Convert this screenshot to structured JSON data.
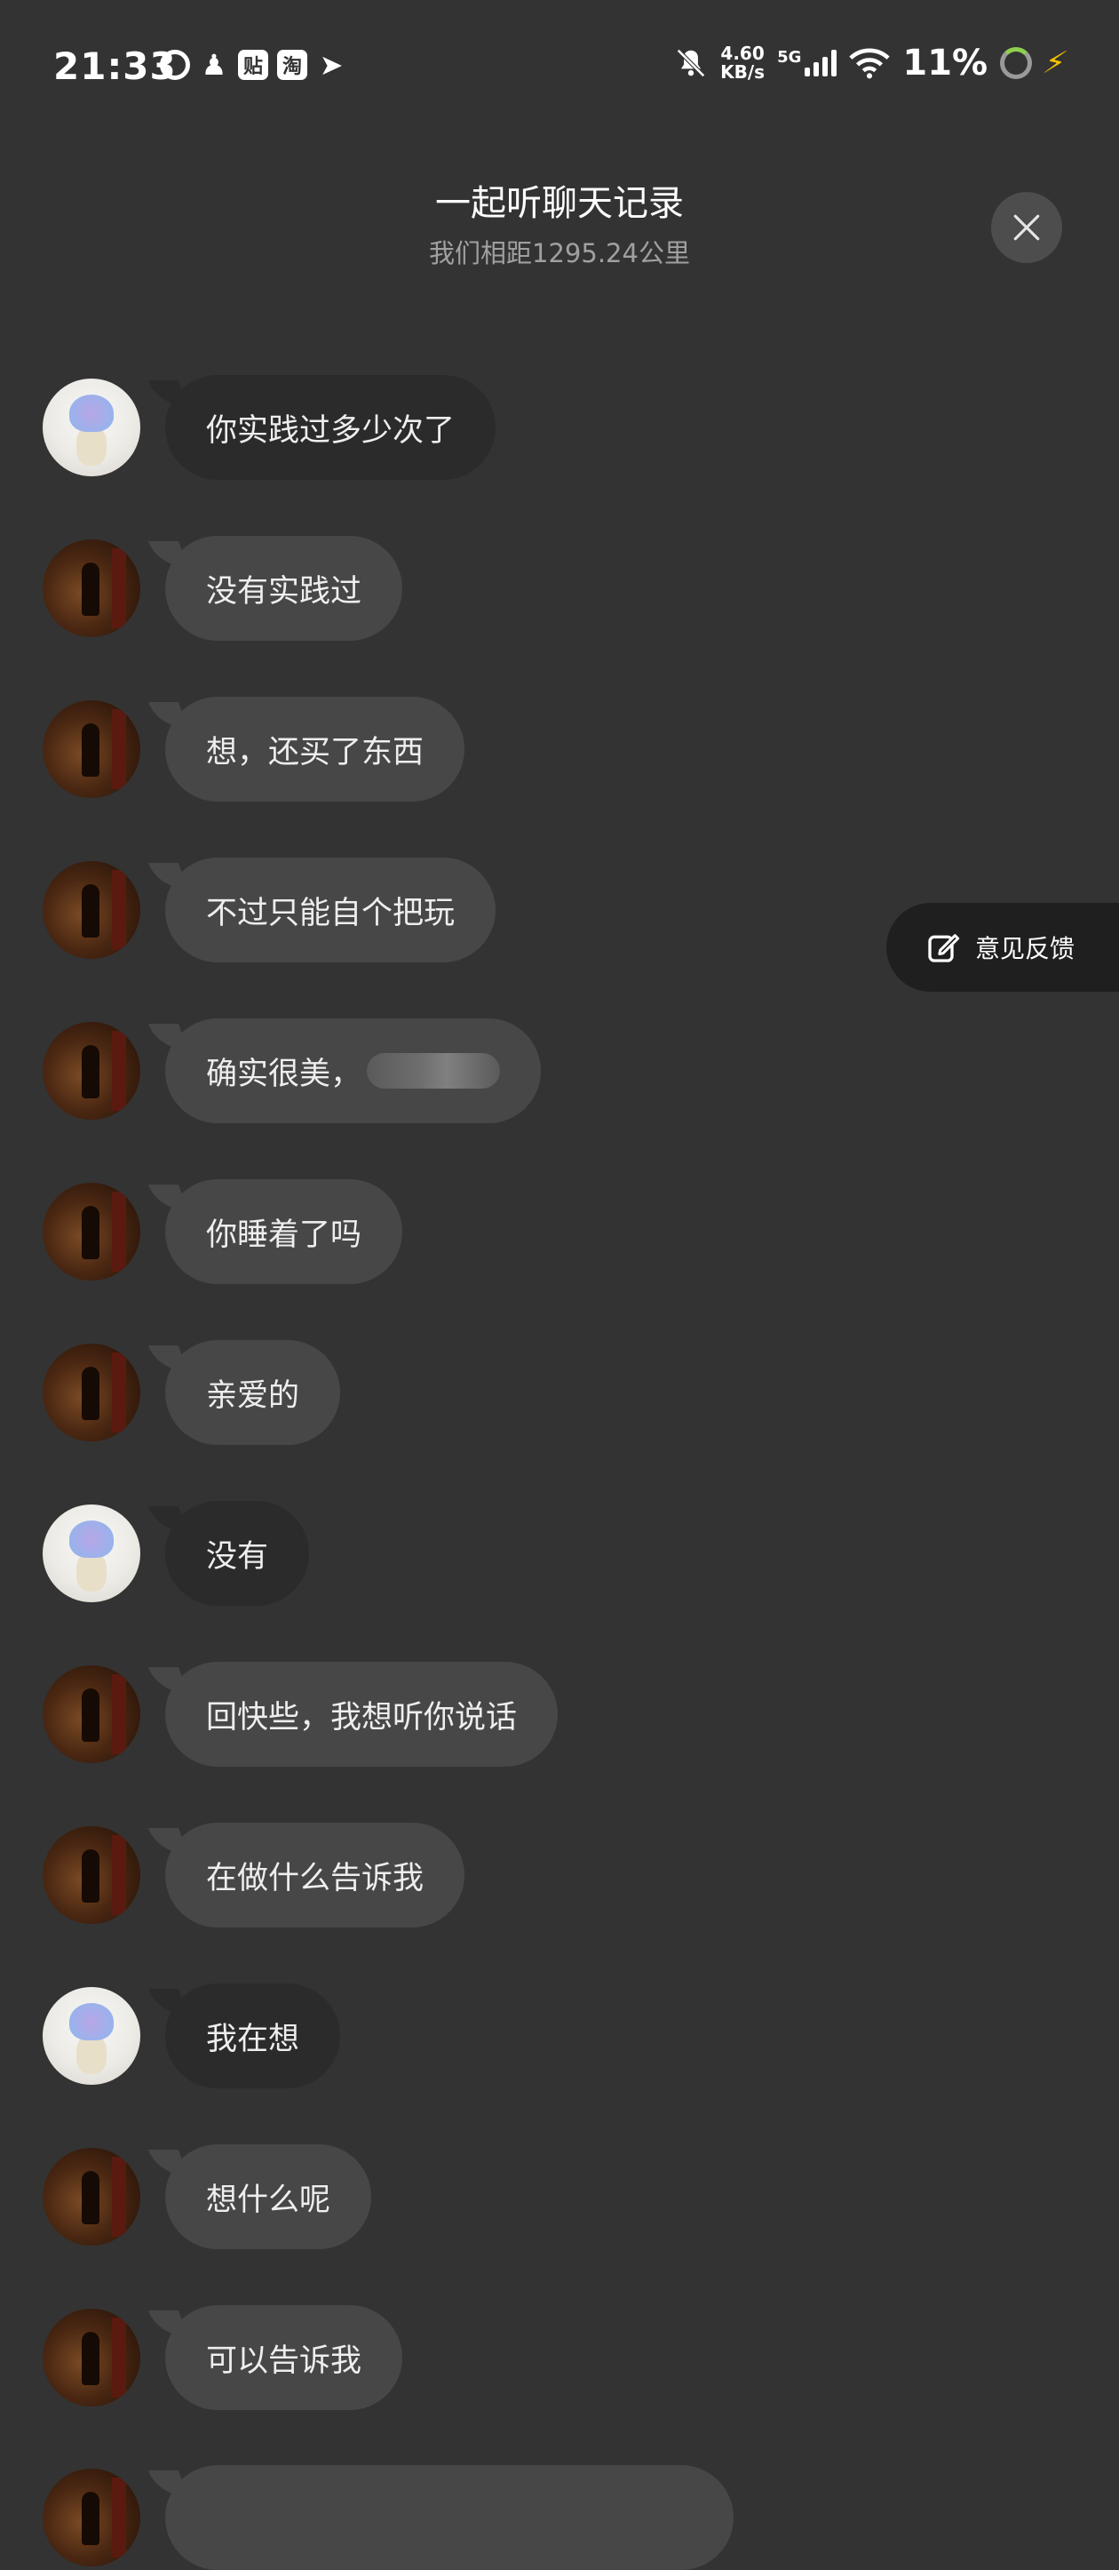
{
  "status_bar": {
    "time": "21:33",
    "app_icons": [
      "weibo-icon",
      "fitness-icon",
      "tieba-icon",
      "taobao-icon",
      "alipay-icon"
    ],
    "app_icon_chars": {
      "tieba": "贴",
      "taobao": "淘"
    },
    "net_speed_value": "4.60",
    "net_speed_unit": "KB/s",
    "network": "5G",
    "battery": "11%"
  },
  "header": {
    "title": "一起听聊天记录",
    "subtitle": "我们相距1295.24公里"
  },
  "messages": [
    {
      "sender": "me",
      "text": "你实践过多少次了"
    },
    {
      "sender": "other",
      "text": "没有实践过"
    },
    {
      "sender": "other",
      "text": "想，还买了东西"
    },
    {
      "sender": "other",
      "text": "不过只能自个把玩"
    },
    {
      "sender": "other",
      "text": "确实很美，"
    },
    {
      "sender": "other",
      "text": "你睡着了吗"
    },
    {
      "sender": "other",
      "text": "亲爱的"
    },
    {
      "sender": "me",
      "text": "没有"
    },
    {
      "sender": "other",
      "text": "回快些，我想听你说话"
    },
    {
      "sender": "other",
      "text": "在做什么告诉我"
    },
    {
      "sender": "me",
      "text": "我在想"
    },
    {
      "sender": "other",
      "text": "想什么呢"
    },
    {
      "sender": "other",
      "text": "可以告诉我"
    }
  ],
  "feedback": {
    "label": "意见反馈"
  },
  "colors": {
    "background": "#333333",
    "bubble_other": "#474747",
    "bubble_me": "#2b2b2b",
    "subtitle": "#a0a0a0",
    "charging": "#f2c200"
  }
}
